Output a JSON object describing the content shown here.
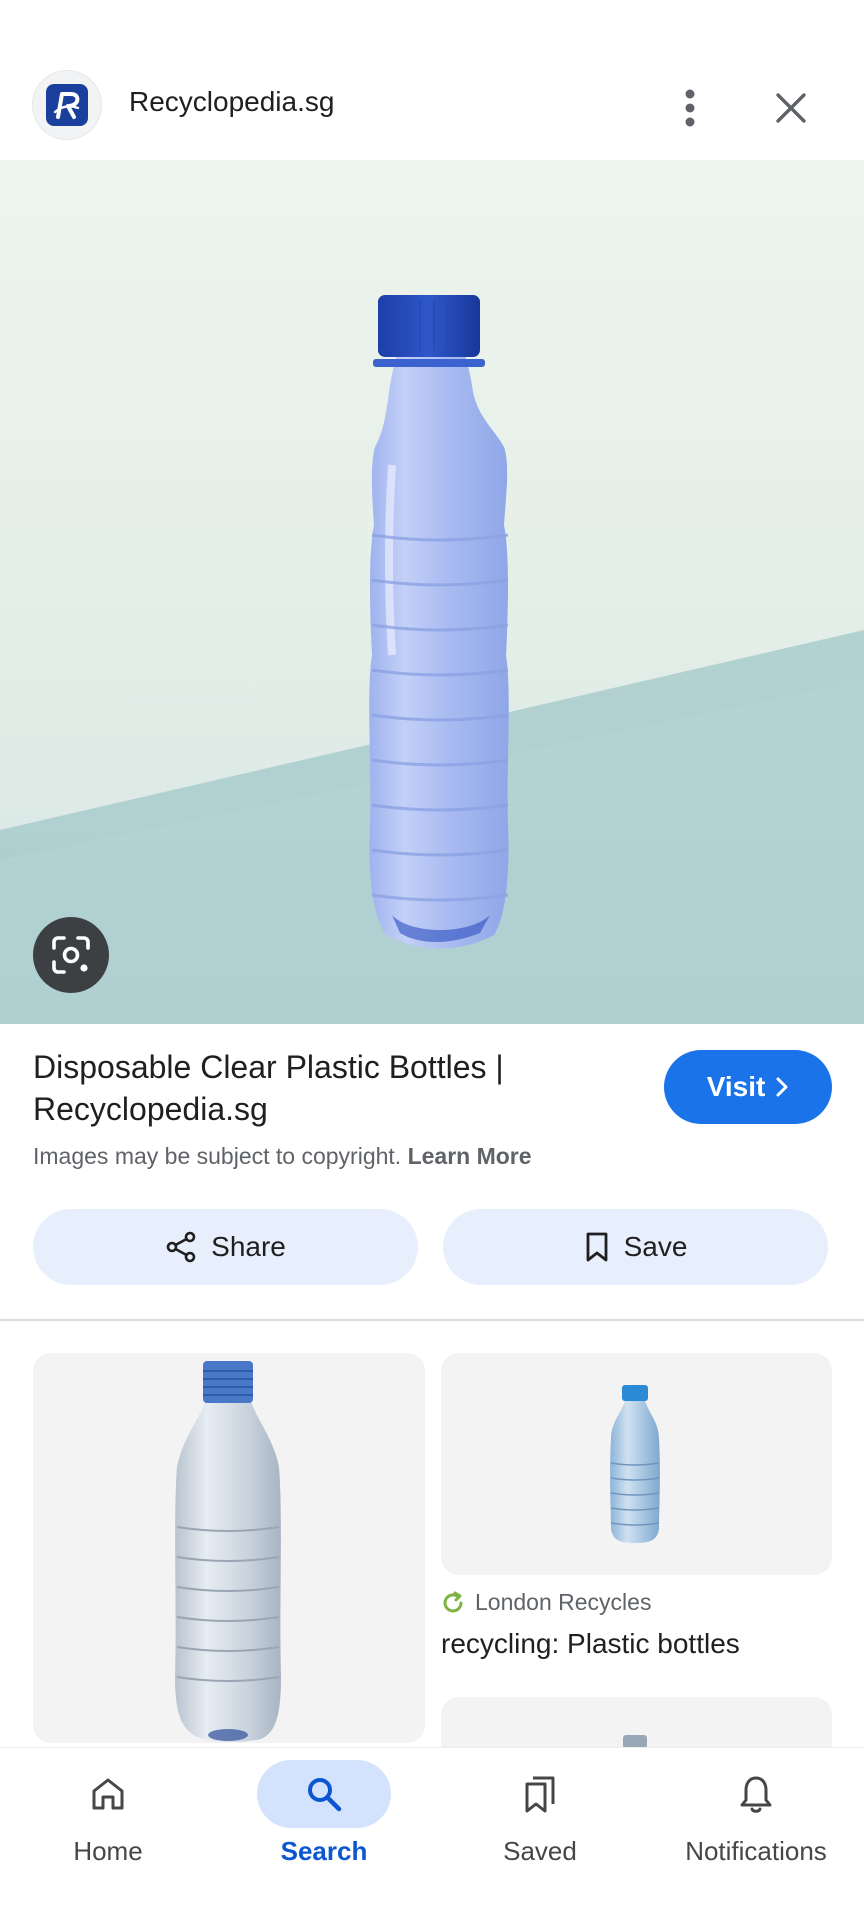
{
  "site": {
    "name": "Recyclopedia.sg"
  },
  "result": {
    "title": "Disposable Clear Plastic Bottles | Recyclopedia.sg",
    "copyright_text": "Images may be subject to copyright.",
    "learn_more": "Learn More",
    "visit_label": "Visit"
  },
  "actions": {
    "share_label": "Share",
    "save_label": "Save"
  },
  "related": [
    {
      "source": "London Recycles",
      "title": "recycling: Plastic bottles"
    }
  ],
  "nav": {
    "items": [
      {
        "label": "Home",
        "icon": "home-icon"
      },
      {
        "label": "Search",
        "icon": "search-icon",
        "active": true
      },
      {
        "label": "Saved",
        "icon": "saved-icon"
      },
      {
        "label": "Notifications",
        "icon": "bell-icon"
      }
    ]
  },
  "colors": {
    "accent": "#1a73e8",
    "pill_bg": "#e8effc",
    "nav_active_bg": "#d3e3fd",
    "logo_bg": "#1a3f9c"
  }
}
